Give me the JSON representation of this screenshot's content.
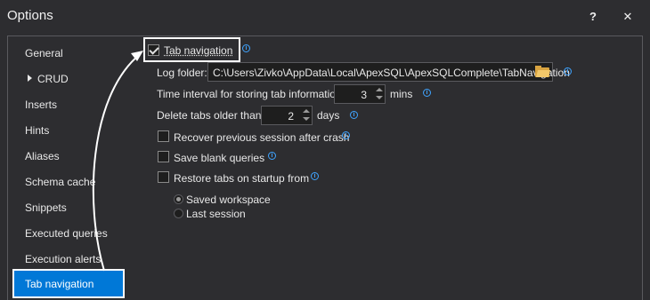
{
  "window": {
    "title": "Options",
    "help_label": "?",
    "close_label": "✕"
  },
  "sidebar": {
    "items": [
      {
        "label": "General"
      },
      {
        "label": "CRUD"
      },
      {
        "label": "Inserts"
      },
      {
        "label": "Hints"
      },
      {
        "label": "Aliases"
      },
      {
        "label": "Schema cache"
      },
      {
        "label": "Snippets"
      },
      {
        "label": "Executed queries"
      },
      {
        "label": "Execution alerts"
      },
      {
        "label": "Tab navigation",
        "selected": true
      }
    ]
  },
  "settings": {
    "tab_navigation": {
      "label": "Tab navigation",
      "checked": true
    },
    "log_folder": {
      "label": "Log folder:",
      "value": "C:\\Users\\Zivko\\AppData\\Local\\ApexSQL\\ApexSQLComplete\\TabNavigation"
    },
    "interval": {
      "label": "Time interval for storing tab information:",
      "value": "3",
      "unit": "mins"
    },
    "delete_tabs": {
      "label": "Delete tabs older than:",
      "value": "2",
      "unit": "days"
    },
    "recover_session": {
      "label": "Recover previous session after crash",
      "checked": false
    },
    "save_blank": {
      "label": "Save blank queries",
      "checked": false
    },
    "restore_tabs": {
      "label": "Restore tabs on startup from",
      "checked": false,
      "options": [
        {
          "label": "Saved workspace",
          "selected": true
        },
        {
          "label": "Last session",
          "selected": false
        }
      ]
    }
  },
  "icons": {
    "info": "info-icon",
    "folder": "folder-icon",
    "check": "checkmark-icon"
  },
  "colors": {
    "accent": "#0078d7",
    "background": "#2d2d30",
    "info": "#3fa4ff"
  }
}
